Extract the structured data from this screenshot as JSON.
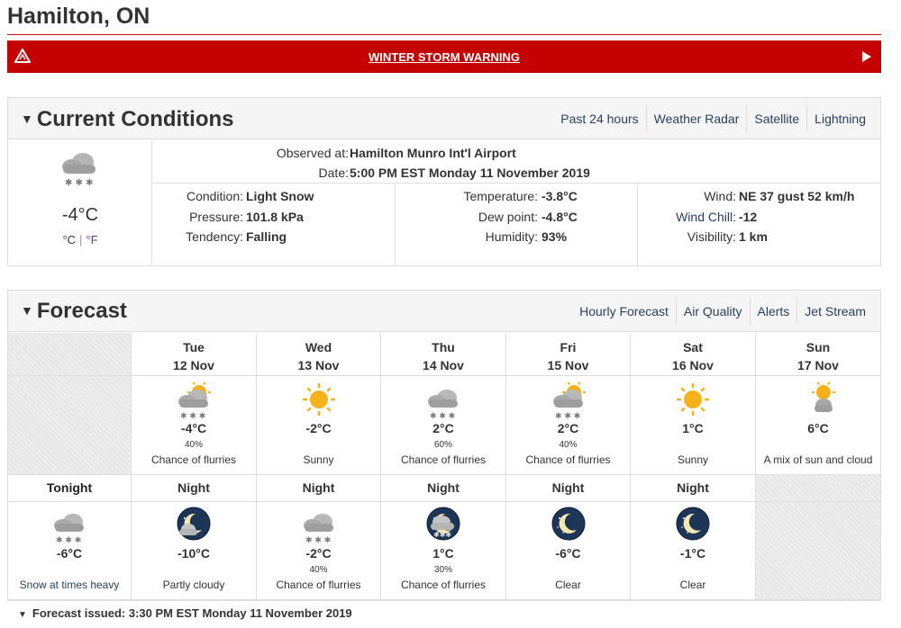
{
  "page": {
    "title": "Hamilton, ON"
  },
  "warning": {
    "label": "WINTER STORM WARNING",
    "color": "#c40000"
  },
  "current": {
    "heading": "Current Conditions",
    "links": [
      "Past 24 hours",
      "Weather Radar",
      "Satellite",
      "Lightning"
    ],
    "icon": "snow-cloud-icon",
    "temp": "-4°C",
    "unit_c": "°C",
    "unit_f": "°F",
    "observed_label": "Observed at:",
    "observed_value": "Hamilton Munro Int'l Airport",
    "date_label": "Date:",
    "date_value": "5:00 PM EST Monday 11 November 2019",
    "condition_label": "Condition:",
    "condition_value": "Light Snow",
    "pressure_label": "Pressure:",
    "pressure_value": "101.8 kPa",
    "tendency_label": "Tendency:",
    "tendency_value": "Falling",
    "temperature_label": "Temperature:",
    "temperature_value": "-3.8°C",
    "dewpoint_label": "Dew point:",
    "dewpoint_value": "-4.8°C",
    "humidity_label": "Humidity:",
    "humidity_value": "93%",
    "wind_label": "Wind:",
    "wind_value": "NE 37 gust 52 km/h",
    "windchill_label": "Wind Chill",
    "windchill_value": "-12",
    "visibility_label": "Visibility:",
    "visibility_value": "1 km"
  },
  "forecast": {
    "heading": "Forecast",
    "links": [
      "Hourly Forecast",
      "Air Quality",
      "Alerts",
      "Jet Stream"
    ],
    "days": [
      {
        "day": "Tue",
        "date": "12 Nov",
        "icon": "sun-cloud-snow-icon",
        "temp": "-4°C",
        "pop": "40%",
        "summary": "Chance of flurries"
      },
      {
        "day": "Wed",
        "date": "13 Nov",
        "icon": "sun-icon",
        "temp": "-2°C",
        "pop": "",
        "summary": "Sunny"
      },
      {
        "day": "Thu",
        "date": "14 Nov",
        "icon": "snow-cloud-icon",
        "temp": "2°C",
        "pop": "60%",
        "summary": "Chance of flurries"
      },
      {
        "day": "Fri",
        "date": "15 Nov",
        "icon": "sun-cloud-snow-icon",
        "temp": "2°C",
        "pop": "40%",
        "summary": "Chance of flurries"
      },
      {
        "day": "Sat",
        "date": "16 Nov",
        "icon": "sun-icon",
        "temp": "1°C",
        "pop": "",
        "summary": "Sunny"
      },
      {
        "day": "Sun",
        "date": "17 Nov",
        "icon": "sun-cloud-icon",
        "temp": "6°C",
        "pop": "",
        "summary": "A mix of sun and cloud"
      }
    ],
    "nights": [
      {
        "label": "Tonight",
        "icon": "snow-cloud-icon",
        "temp": "-6°C",
        "pop": "",
        "summary": "Snow at times heavy"
      },
      {
        "label": "Night",
        "icon": "moon-cloud-icon",
        "temp": "-10°C",
        "pop": "",
        "summary": "Partly cloudy"
      },
      {
        "label": "Night",
        "icon": "snow-cloud-icon",
        "temp": "-2°C",
        "pop": "40%",
        "summary": "Chance of flurries"
      },
      {
        "label": "Night",
        "icon": "moon-cloud-snow-icon",
        "temp": "1°C",
        "pop": "30%",
        "summary": "Chance of flurries"
      },
      {
        "label": "Night",
        "icon": "moon-icon",
        "temp": "-6°C",
        "pop": "",
        "summary": "Clear"
      },
      {
        "label": "Night",
        "icon": "moon-icon",
        "temp": "-1°C",
        "pop": "",
        "summary": "Clear"
      }
    ],
    "issued": "Forecast issued: 3:30 PM EST Monday 11 November 2019"
  }
}
